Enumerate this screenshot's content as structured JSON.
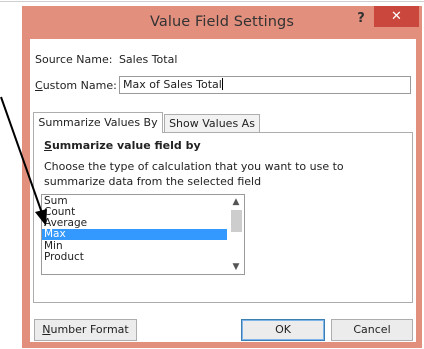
{
  "dialog": {
    "title": "Value Field Settings",
    "help_glyph": "?",
    "close_glyph": "✕"
  },
  "source": {
    "label": "Source Name:",
    "value": "Sales Total"
  },
  "custom_name": {
    "label_underlined": "C",
    "label_rest": "ustom Name:",
    "value": "Max of Sales Total"
  },
  "tabs": [
    {
      "label": "Summarize Values By",
      "active": true
    },
    {
      "label": "Show Values As",
      "active": false
    }
  ],
  "summarize": {
    "heading_underlined": "S",
    "heading_rest": "ummarize value field by",
    "description": "Choose the type of calculation that you want to use to summarize data from the selected field",
    "options": [
      "Sum",
      "Count",
      "Average",
      "Max",
      "Min",
      "Product"
    ],
    "selected": "Max"
  },
  "buttons": {
    "number_format_underlined": "N",
    "number_format_rest": "umber Format",
    "ok": "OK",
    "cancel": "Cancel"
  },
  "colors": {
    "title_bar": "#e28f7d",
    "close_button": "#c9473c",
    "selection": "#3399ff"
  },
  "icons": {
    "scroll_up": "▲",
    "scroll_down": "▼"
  }
}
